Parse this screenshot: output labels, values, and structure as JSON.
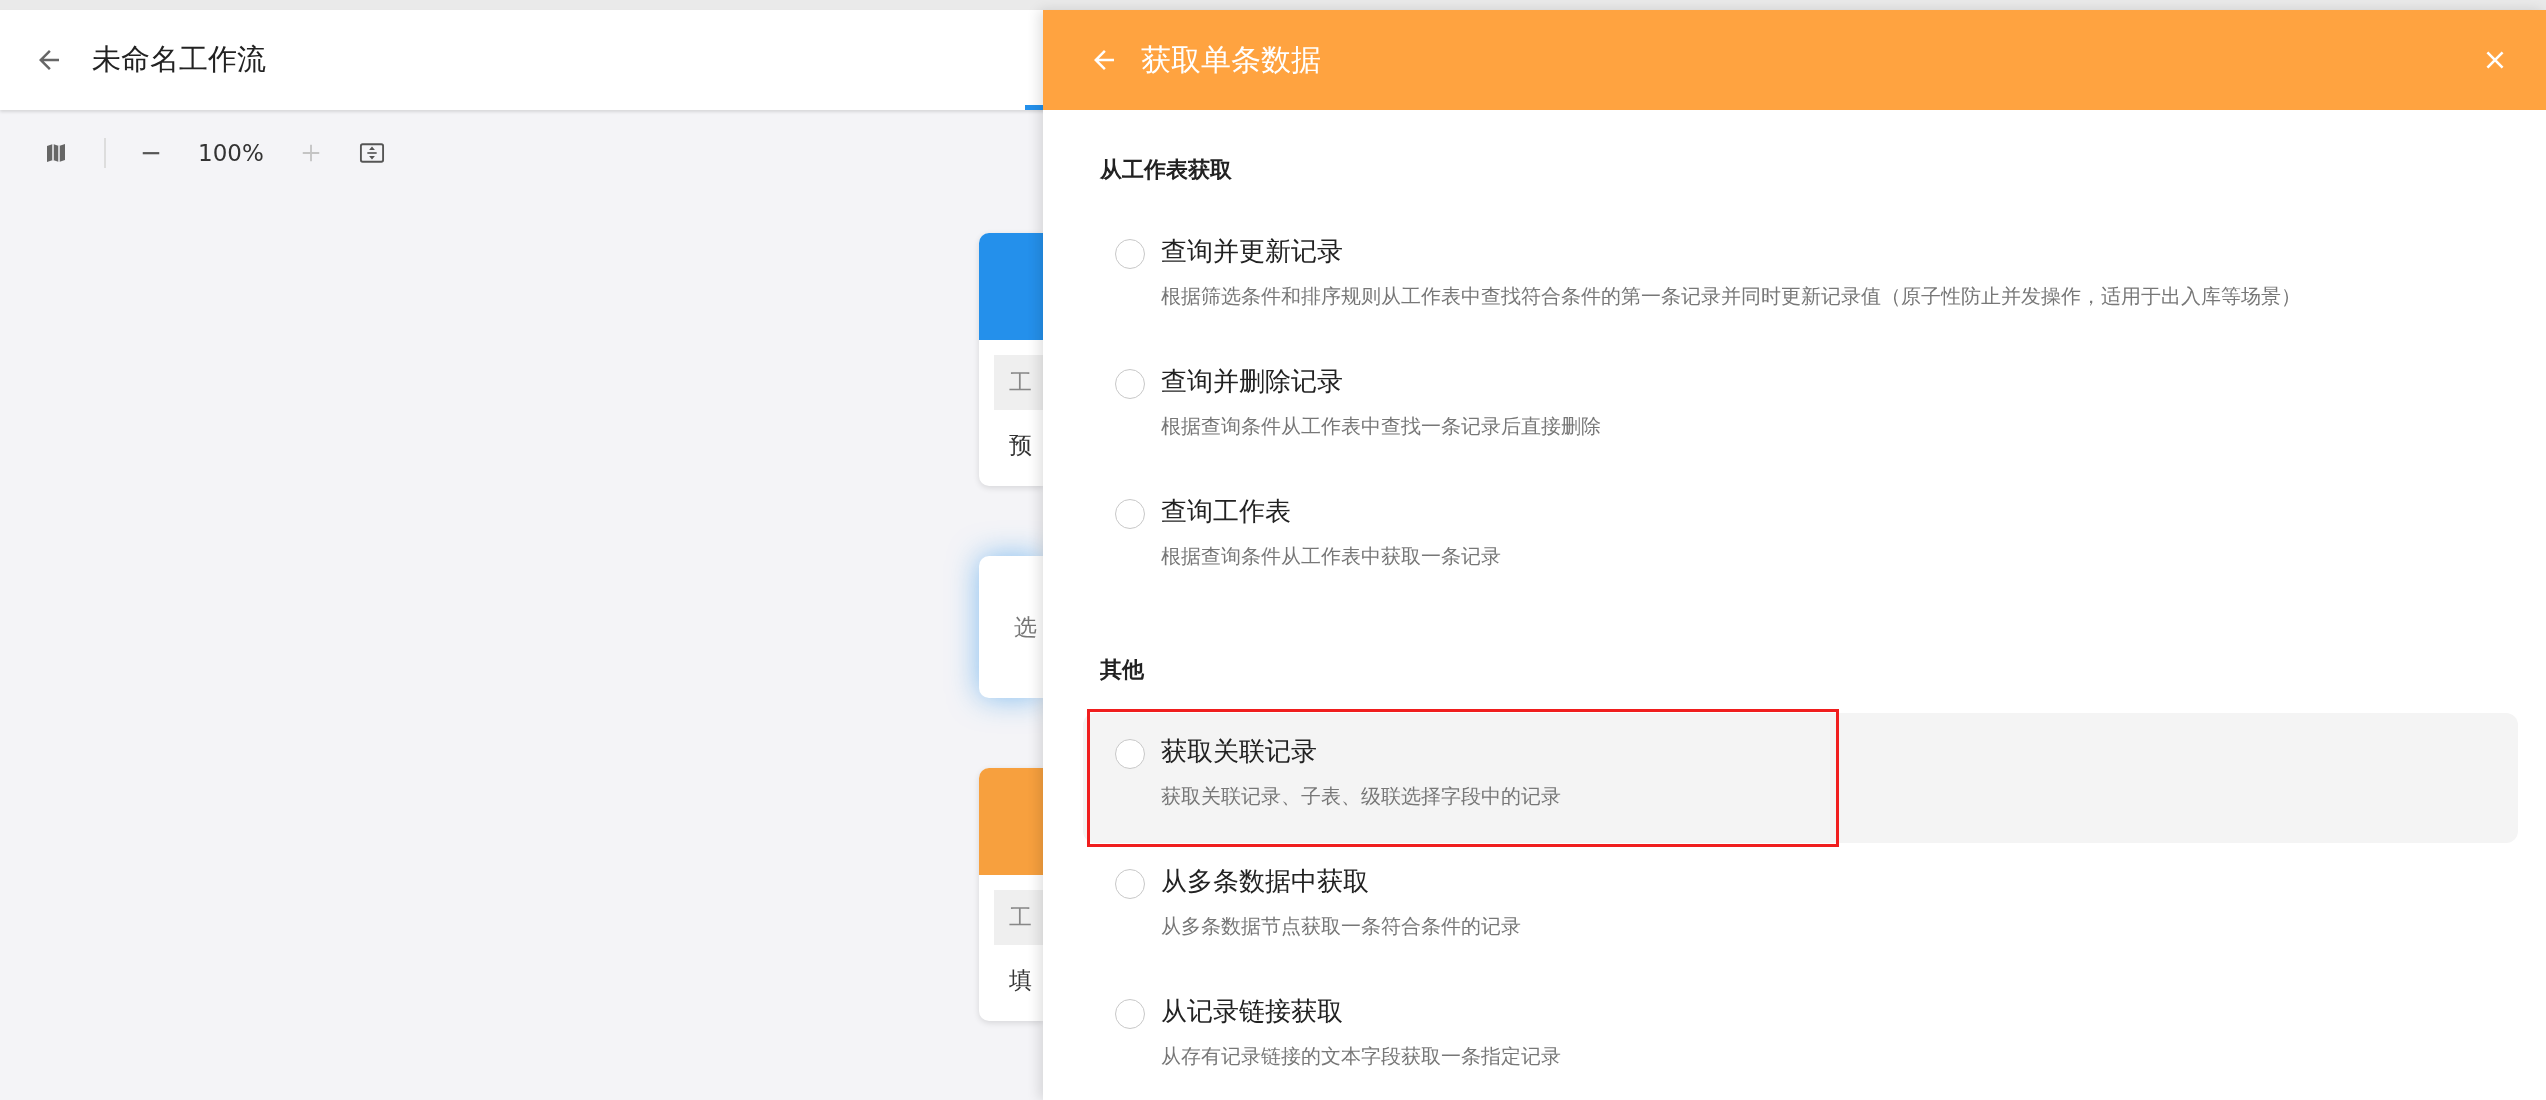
{
  "workflow": {
    "title": "未命名工作流",
    "tab_active": true
  },
  "toolbar": {
    "zoom": "100%",
    "zoom_in_disabled": true
  },
  "canvas_nodes": [
    {
      "kind": "header-card",
      "color": "#2490eb",
      "selected": false,
      "field": "工",
      "text": "预"
    },
    {
      "kind": "plain-card",
      "selected": true,
      "text": "选"
    },
    {
      "kind": "header-card",
      "color": "#f7a03e",
      "selected": false,
      "field": "工",
      "text": "填"
    }
  ],
  "panel": {
    "title": "获取单条数据",
    "sections": [
      {
        "title": "从工作表获取",
        "options": [
          {
            "title": "查询并更新记录",
            "description": "根据筛选条件和排序规则从工作表中查找符合条件的第一条记录并同时更新记录值（原子性防止并发操作，适用于出入库等场景）",
            "checked": false,
            "highlighted": false
          },
          {
            "title": "查询并删除记录",
            "description": "根据查询条件从工作表中查找一条记录后直接删除",
            "checked": false,
            "highlighted": false
          },
          {
            "title": "查询工作表",
            "description": "根据查询条件从工作表中获取一条记录",
            "checked": false,
            "highlighted": false
          }
        ]
      },
      {
        "title": "其他",
        "options": [
          {
            "title": "获取关联记录",
            "description": "获取关联记录、子表、级联选择字段中的记录",
            "checked": false,
            "highlighted": true
          },
          {
            "title": "从多条数据中获取",
            "description": "从多条数据节点获取一条符合条件的记录",
            "checked": false,
            "highlighted": false
          },
          {
            "title": "从记录链接获取",
            "description": "从存有记录链接的文本字段获取一条指定记录",
            "checked": false,
            "highlighted": false
          }
        ]
      }
    ]
  }
}
